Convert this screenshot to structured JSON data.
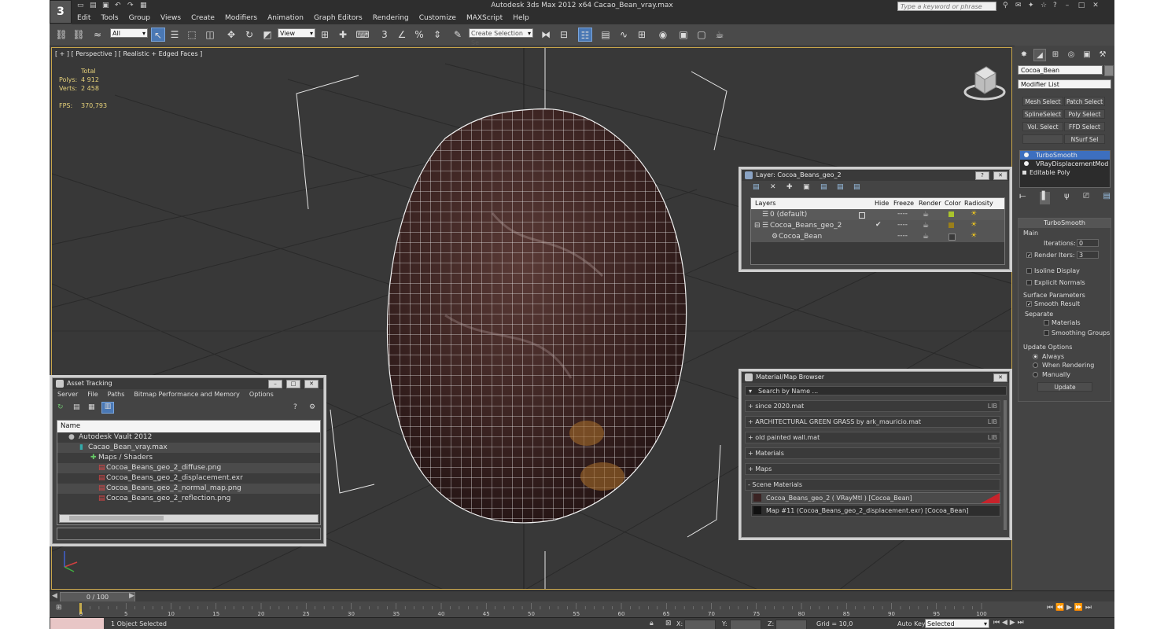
{
  "app": {
    "title": "Autodesk 3ds Max  2012 x64      Cacao_Bean_vray.max",
    "logo": "3",
    "search_placeholder": "Type a keyword or phrase"
  },
  "menu": [
    "Edit",
    "Tools",
    "Group",
    "Views",
    "Create",
    "Modifiers",
    "Animation",
    "Graph Editors",
    "Rendering",
    "Customize",
    "MAXScript",
    "Help"
  ],
  "toolbar": {
    "filter_value": "All",
    "refcoord_value": "View",
    "selection_set_placeholder": "Create Selection Se"
  },
  "viewport": {
    "label": "[ + ] [ Perspective ] [ Realistic + Edged Faces ]",
    "stats": {
      "header": "Total",
      "polys_label": "Polys:",
      "polys": "4 912",
      "verts_label": "Verts:",
      "verts": "2 458",
      "fps_label": "FPS:",
      "fps": "370,793"
    }
  },
  "layer_panel": {
    "title": "Layer: Cocoa_Beans_geo_2",
    "columns": [
      "Layers",
      "Hide",
      "Freeze",
      "Render",
      "Color",
      "Radiosity"
    ],
    "rows": [
      {
        "name": "0 (default)",
        "hide": "",
        "freeze": "----",
        "color": "#aac42c"
      },
      {
        "name": "Cocoa_Beans_geo_2",
        "hide": "✔",
        "freeze": "----",
        "color": "#9a7f1a"
      },
      {
        "name": "Cocoa_Bean",
        "hide": "",
        "freeze": "----",
        "color": "#3a3a3a"
      }
    ]
  },
  "asset_panel": {
    "title": "Asset Tracking",
    "menu": [
      "Server",
      "File",
      "Paths",
      "Bitmap Performance and Memory",
      "Options"
    ],
    "column": "Name",
    "rows": [
      "Autodesk Vault 2012",
      "Cacao_Bean_vray.max",
      "Maps / Shaders",
      "Cocoa_Beans_geo_2_diffuse.png",
      "Cocoa_Beans_geo_2_displacement.exr",
      "Cocoa_Beans_geo_2_normal_map.png",
      "Cocoa_Beans_geo_2_reflection.png"
    ]
  },
  "material_panel": {
    "title": "Material/Map Browser",
    "search_placeholder": "Search by Name ...",
    "groups": [
      {
        "label": "+ since 2020.mat",
        "tag": "LIB"
      },
      {
        "label": "+ ARCHITECTURAL GREEN GRASS by ark_mauricio.mat",
        "tag": "LIB"
      },
      {
        "label": "+ old painted wall.mat",
        "tag": "LIB"
      },
      {
        "label": "+ Materials",
        "tag": ""
      },
      {
        "label": "+ Maps",
        "tag": ""
      },
      {
        "label": "- Scene Materials",
        "tag": ""
      }
    ],
    "scene_items": [
      "Cocoa_Beans_geo_2  ( VRayMtl )  [Cocoa_Bean]",
      "Map #11 (Cocoa_Beans_geo_2_displacement.exr)  [Cocoa_Bean]"
    ]
  },
  "command_panel": {
    "object_name": "Cocoa_Bean",
    "modifier_list": "Modifier List",
    "buttons": [
      "Mesh Select",
      "Patch Select",
      "SplineSelect",
      "Poly Select",
      "Vol. Select",
      "FFD Select",
      "NSurf Sel"
    ],
    "stack": [
      "TurboSmooth",
      "VRayDisplacementMod",
      "Editable Poly"
    ],
    "turbosmooth": {
      "title": "TurboSmooth",
      "main": "Main",
      "iterations_label": "Iterations:",
      "iterations": "0",
      "render_iters_label": "Render Iters:",
      "render_iters": "3",
      "isoline": "Isoline Display",
      "explicit_normals": "Explicit Normals",
      "surface_params": "Surface Parameters",
      "smooth_result": "Smooth Result",
      "separate": "Separate",
      "materials": "Materials",
      "smoothing_groups": "Smoothing Groups",
      "update_options": "Update Options",
      "always": "Always",
      "when_rendering": "When Rendering",
      "manually": "Manually",
      "update_button": "Update"
    }
  },
  "timeline": {
    "frame": "0 / 100",
    "ticks": [
      "0",
      "5",
      "10",
      "15",
      "20",
      "25",
      "30",
      "35",
      "40",
      "45",
      "50",
      "55",
      "60",
      "65",
      "70",
      "75",
      "80",
      "85",
      "90",
      "95",
      "100"
    ]
  },
  "status": {
    "selected": "1 Object Selected",
    "x_label": "X:",
    "y_label": "Y:",
    "z_label": "Z:",
    "grid": "Grid = 10,0",
    "autokey": "Auto Key",
    "selected_dd": "Selected"
  }
}
